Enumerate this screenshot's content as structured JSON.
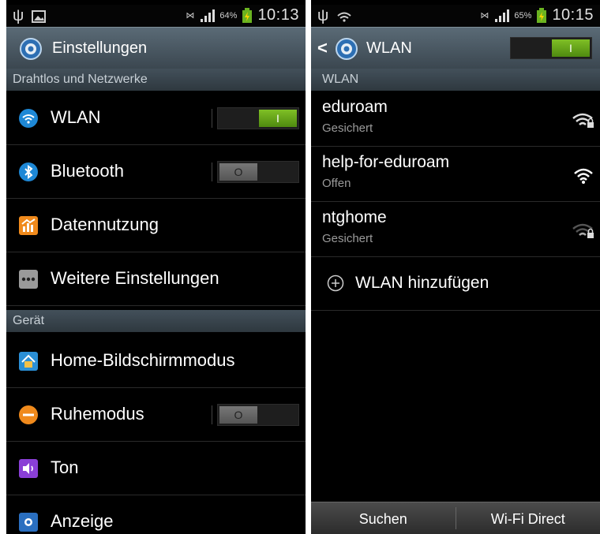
{
  "left": {
    "status": {
      "battery": "64%",
      "time": "10:13"
    },
    "title": "Einstellungen",
    "sections": [
      {
        "header": "Drahtlos und Netzwerke",
        "items": [
          {
            "label": "WLAN"
          },
          {
            "label": "Bluetooth"
          },
          {
            "label": "Datennutzung"
          },
          {
            "label": "Weitere Einstellungen"
          }
        ]
      },
      {
        "header": "Gerät",
        "items": [
          {
            "label": "Home-Bildschirmmodus"
          },
          {
            "label": "Ruhemodus"
          },
          {
            "label": "Ton"
          },
          {
            "label": "Anzeige"
          }
        ]
      }
    ],
    "toggle_on_mark": "I",
    "toggle_off_mark": "O"
  },
  "right": {
    "status": {
      "battery": "65%",
      "time": "10:15"
    },
    "back": "<",
    "title": "WLAN",
    "toggle_on_mark": "I",
    "section_header": "WLAN",
    "networks": [
      {
        "ssid": "eduroam",
        "security": "Gesichert"
      },
      {
        "ssid": "help-for-eduroam",
        "security": "Offen"
      },
      {
        "ssid": "ntghome",
        "security": "Gesichert"
      }
    ],
    "add_label": "WLAN hinzufügen",
    "buttons": {
      "search": "Suchen",
      "wifi_direct": "Wi-Fi Direct"
    }
  },
  "colors": {
    "accent_green": "#6aaa1c",
    "header_blue": "#4a5a66"
  }
}
